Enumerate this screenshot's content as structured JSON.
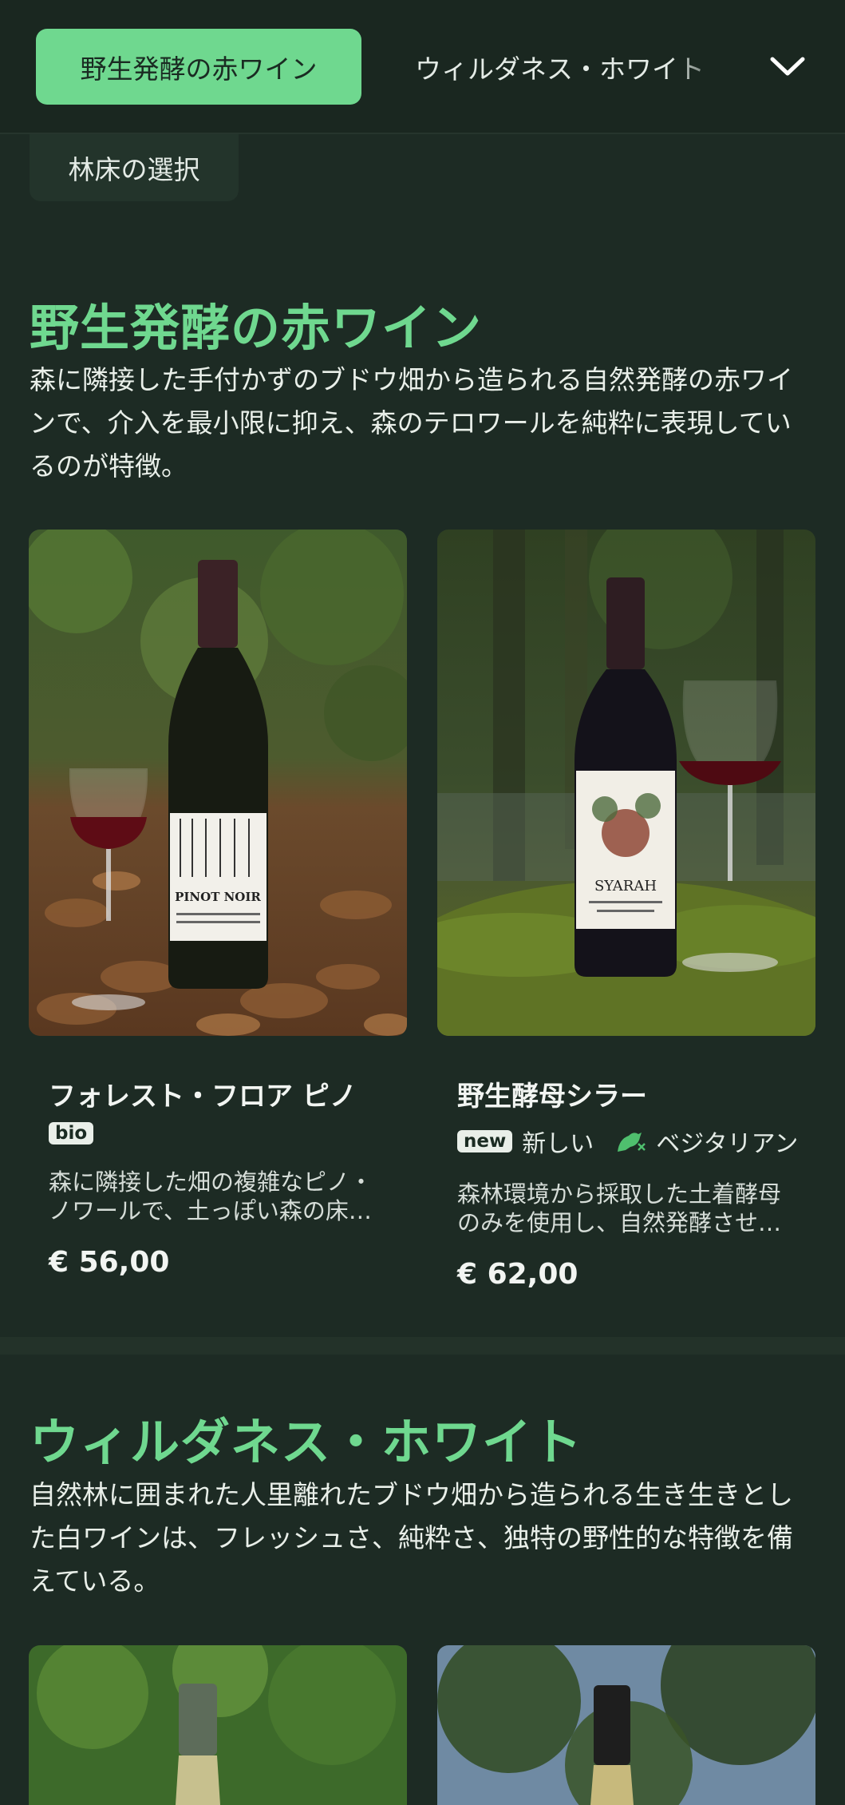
{
  "nav": {
    "active_tab": "野生発酵の赤ワイン",
    "next_tab": "ウィルダネス・ホワイト",
    "second_row_tab": "林床の選択",
    "expand_icon": "chevron-down-icon"
  },
  "sections": [
    {
      "title": "野生発酵の赤ワイン",
      "description": "森に隣接した手付かずのブドウ畑から造られる自然発酵の赤ワインで、介入を最小限に抑え、森のテロワールを純粋に表現しているのが特徴。",
      "products": [
        {
          "name": "フォレスト・フロア ピノ",
          "badge": "bio",
          "tags": [],
          "description": "森に隣接した畑の複雑なピノ・ノワールで、土っぽい森の床の香りが特徴の一本です。",
          "price": "€ 56,00",
          "bottle_label": "PINOT NOIR"
        },
        {
          "name": "野生酵母シラー",
          "badge": "new",
          "tags": [
            "新しい",
            "ベジタリアン"
          ],
          "description": "森林環境から採取した土着酵母のみを使用し、自然発酵させたシラーです。",
          "price": "€ 62,00",
          "bottle_label": "SYARAH"
        }
      ]
    },
    {
      "title": "ウィルダネス・ホワイト",
      "description": "自然林に囲まれた人里離れたブドウ畑から造られる生き生きとした白ワインは、フレッシュさ、純粋さ、独特の野性的な特徴を備えている。"
    }
  ],
  "colors": {
    "background": "#1d2b24",
    "accent": "#6fd88f",
    "text": "#e9efe9"
  }
}
